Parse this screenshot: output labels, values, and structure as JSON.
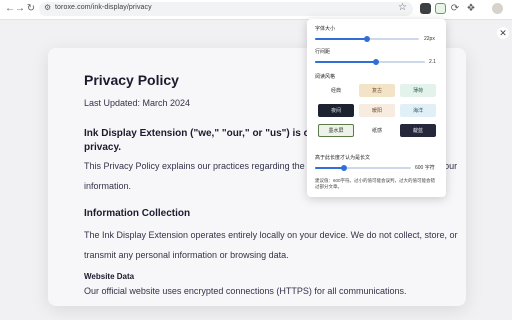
{
  "browser": {
    "url": "toroxe.com/ink-display/privacy"
  },
  "page": {
    "close_glyph": "✕"
  },
  "doc": {
    "title": "Privacy Policy",
    "last_updated": "Last Updated: March 2024",
    "lead": "Ink Display Extension (\"we,\" \"our,\" or \"us\") is committed to protecting your privacy.",
    "intro": "This Privacy Policy explains our practices regarding the collection, use, and disclosure of your information.",
    "info_heading": "Information Collection",
    "info_body": "The Ink Display Extension operates entirely locally on your device. We do not collect, store, or transmit any personal information or browsing data.",
    "website_heading": "Website Data",
    "website_body": "Our official website uses encrypted connections (HTTPS) for all communications."
  },
  "popup": {
    "font_size_label": "字体大小",
    "font_size": 22,
    "font_size_min": 12,
    "font_size_max": 32,
    "font_size_text": "22px",
    "line_height_label": "行间距",
    "line_height": 2.1,
    "line_height_min": 1.0,
    "line_height_max": 3.0,
    "line_height_text": "2.1",
    "style_label": "阅读风格",
    "themes": [
      {
        "label": "经典",
        "bg": "#ffffff",
        "fg": "#333333",
        "border": "#ffffff"
      },
      {
        "label": "复古",
        "bg": "#f3e4c8",
        "fg": "#6a5030",
        "border": "#f3e4c8"
      },
      {
        "label": "薄荷",
        "bg": "#e3f3ec",
        "fg": "#2d5b47",
        "border": "#e3f3ec"
      },
      {
        "label": "夜间",
        "bg": "#1c2230",
        "fg": "#e6e6e6",
        "border": "#1c2230"
      },
      {
        "label": "暖阳",
        "bg": "#f8ebe0",
        "fg": "#6a4a30",
        "border": "#f8ebe0"
      },
      {
        "label": "海洋",
        "bg": "#e1f0f6",
        "fg": "#2f5a70",
        "border": "#e1f0f6"
      },
      {
        "label": "墨水屏",
        "bg": "#eef3ea",
        "fg": "#2c3b2a",
        "border": "#5b7a4a"
      },
      {
        "label": "纸感",
        "bg": "#ffffff",
        "fg": "#333333",
        "border": "#ffffff"
      },
      {
        "label": "靛蓝",
        "bg": "#24283a",
        "fg": "#e8e8f2",
        "border": "#24283a"
      }
    ],
    "min_len_label": "高于此长度才认为是长文",
    "min_len": 600,
    "min_len_min": 0,
    "min_len_max": 2000,
    "min_len_text": "600 字符",
    "min_len_note": "建议值：600字符。过小的值可能会误判，过大的值可能会错过部分文章。"
  },
  "colors": {
    "accent": "#2f6fd6",
    "extension_icon": "#4caf50"
  }
}
